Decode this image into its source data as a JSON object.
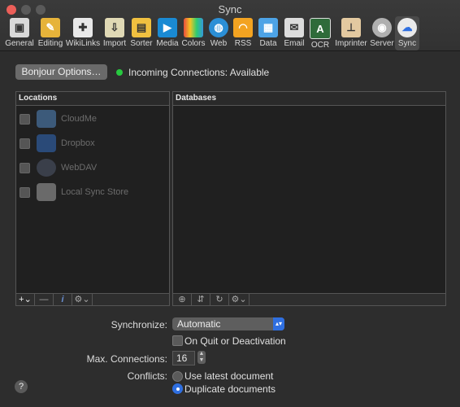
{
  "window": {
    "title": "Sync"
  },
  "toolbar": {
    "items": [
      {
        "label": "General",
        "icon": "general-icon",
        "color": "#d9d9d9"
      },
      {
        "label": "Editing",
        "icon": "pencil-icon",
        "color": "#e6b33a"
      },
      {
        "label": "WikiLinks",
        "icon": "puzzle-icon",
        "color": "#e8e8e8"
      },
      {
        "label": "Import",
        "icon": "import-icon",
        "color": "#e0d9b5"
      },
      {
        "label": "Sorter",
        "icon": "sorter-icon",
        "color": "#f0c040"
      },
      {
        "label": "Media",
        "icon": "media-icon",
        "color": "#1a8ad3"
      },
      {
        "label": "Colors",
        "icon": "colors-icon",
        "color": "#e84c3d"
      },
      {
        "label": "Web",
        "icon": "globe-icon",
        "color": "#2b8fd6"
      },
      {
        "label": "RSS",
        "icon": "rss-icon",
        "color": "#f3a321"
      },
      {
        "label": "Data",
        "icon": "data-icon",
        "color": "#4da3e6"
      },
      {
        "label": "Email",
        "icon": "email-icon",
        "color": "#dcdcdc"
      },
      {
        "label": "OCR",
        "icon": "ocr-icon",
        "color": "#2f6b3a"
      },
      {
        "label": "Imprinter",
        "icon": "stamp-icon",
        "color": "#e3c9a0"
      },
      {
        "label": "Server",
        "icon": "server-icon",
        "color": "#b0b0b0"
      },
      {
        "label": "Sync",
        "icon": "cloud-sync-icon",
        "color": "#eaeaea"
      }
    ]
  },
  "bonjour": {
    "button": "Bonjour Options…",
    "status": "Incoming Connections: Available",
    "status_color": "#27c93f"
  },
  "locations": {
    "header": "Locations",
    "items": [
      {
        "label": "CloudMe",
        "icon": "cloudme-icon"
      },
      {
        "label": "Dropbox",
        "icon": "dropbox-icon"
      },
      {
        "label": "WebDAV",
        "icon": "webdav-icon"
      },
      {
        "label": "Local Sync Store",
        "icon": "local-store-icon"
      }
    ],
    "footer": {
      "add": "+⌄",
      "remove": "—",
      "info": "i",
      "action": "⚙⌄"
    }
  },
  "databases": {
    "header": "Databases",
    "footer": {
      "a": "⊕",
      "b": "⇵",
      "c": "↻",
      "action": "⚙⌄"
    }
  },
  "settings": {
    "synchronize_label": "Synchronize:",
    "synchronize_value": "Automatic",
    "quit_checkbox": "On Quit or Deactivation",
    "max_label": "Max. Connections:",
    "max_value": "16",
    "conflicts_label": "Conflicts:",
    "conflict_options": [
      "Use latest document",
      "Duplicate documents"
    ],
    "conflict_selected": "Duplicate documents"
  },
  "help": "?"
}
